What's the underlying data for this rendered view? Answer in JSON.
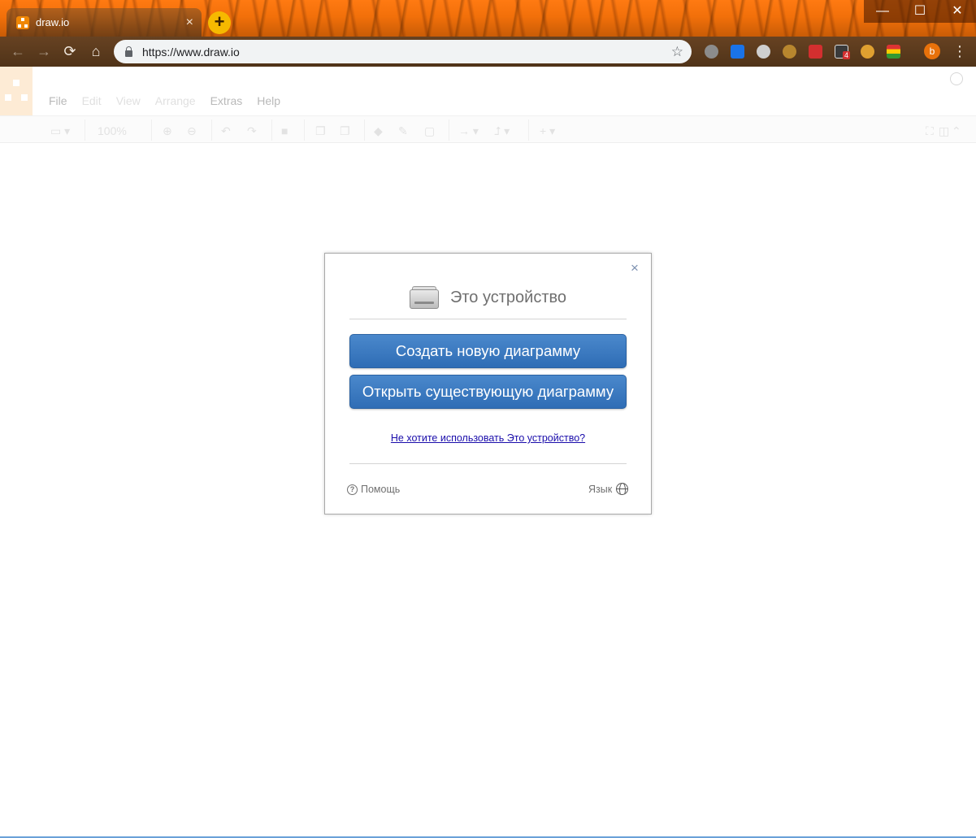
{
  "browser": {
    "tab_title": "draw.io",
    "tab_close": "×",
    "new_tab": "+",
    "url": "https://www.draw.io",
    "window_controls": {
      "minimize": "—",
      "maximize": "☐",
      "close": "✕"
    },
    "profile_initial": "b",
    "extension_badge": "4"
  },
  "app": {
    "menu": [
      "File",
      "Edit",
      "View",
      "Arrange",
      "Extras",
      "Help"
    ],
    "zoom": "100%"
  },
  "dialog": {
    "close": "×",
    "title": "Это устройство",
    "create_button": "Создать новую диаграмму",
    "open_button": "Открыть существующую диаграмму",
    "alt_link": "Не хотите использовать Это устройство?",
    "help_label": "Помощь",
    "language_label": "Язык"
  },
  "colors": {
    "accent_blue": "#3a79c0",
    "link": "#1a0dab",
    "brand_orange": "#f08705"
  }
}
